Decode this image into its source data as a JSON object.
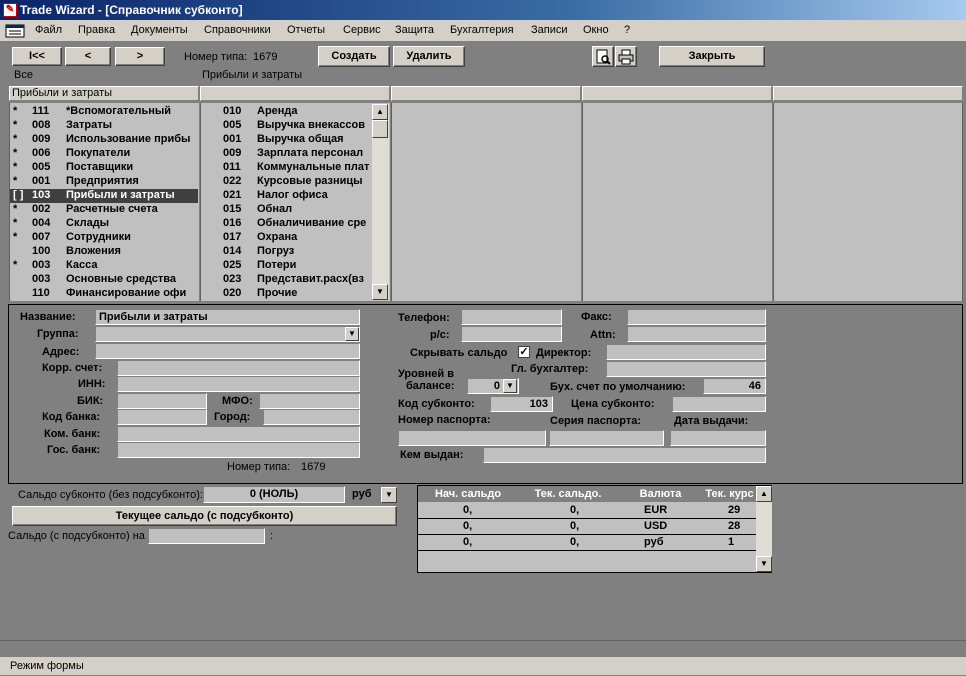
{
  "window": {
    "title": "Trade Wizard - [Справочник субконто]"
  },
  "menu": [
    "Файл",
    "Правка",
    "Документы",
    "Справочники",
    "Отчеты",
    "Сервис",
    "Защита",
    "Бухгалтерия",
    "Записи",
    "Окно",
    "?"
  ],
  "toolbar": {
    "first": "I<<",
    "prev": "<",
    "next": ">",
    "type_label": "Номер типа:",
    "type_value": "1679",
    "create": "Создать",
    "delete": "Удалить",
    "close": "Закрыть"
  },
  "breadcrumb": {
    "left": "Все",
    "right": "Прибыли и затраты"
  },
  "columns": {
    "first_header": "Прибыли и затраты"
  },
  "left_list": [
    {
      "mark": "*",
      "code": "111",
      "name": "*Вспомогательный"
    },
    {
      "mark": "*",
      "code": "008",
      "name": "Затраты"
    },
    {
      "mark": "*",
      "code": "009",
      "name": "Использование прибы"
    },
    {
      "mark": "*",
      "code": "006",
      "name": "Покупатели"
    },
    {
      "mark": "*",
      "code": "005",
      "name": "Поставщики"
    },
    {
      "mark": "*",
      "code": "001",
      "name": "Предприятия"
    },
    {
      "mark": "[ ]",
      "code": "103",
      "name": "Прибыли и затраты"
    },
    {
      "mark": "*",
      "code": "002",
      "name": "Расчетные счета"
    },
    {
      "mark": "*",
      "code": "004",
      "name": "Склады"
    },
    {
      "mark": "*",
      "code": "007",
      "name": "Сотрудники"
    },
    {
      "mark": "",
      "code": "100",
      "name": "Вложения"
    },
    {
      "mark": "*",
      "code": "003",
      "name": "Касса"
    },
    {
      "mark": "",
      "code": "003",
      "name": "Основные средства"
    },
    {
      "mark": "",
      "code": "110",
      "name": "Финансирование офи"
    }
  ],
  "right_list": [
    {
      "code": "010",
      "name": "Аренда"
    },
    {
      "code": "005",
      "name": "Выручка внекассов"
    },
    {
      "code": "001",
      "name": "Выручка общая"
    },
    {
      "code": "009",
      "name": "Зарплата персонал"
    },
    {
      "code": "011",
      "name": "Коммунальные плат"
    },
    {
      "code": "022",
      "name": "Курсовые разницы"
    },
    {
      "code": "021",
      "name": "Налог офиса"
    },
    {
      "code": "015",
      "name": "Обнал"
    },
    {
      "code": "016",
      "name": "Обналичивание сре"
    },
    {
      "code": "017",
      "name": "Охрана"
    },
    {
      "code": "014",
      "name": "Погруз"
    },
    {
      "code": "025",
      "name": "Потери"
    },
    {
      "code": "023",
      "name": "Представит.расх(вз"
    },
    {
      "code": "020",
      "name": "Прочие"
    }
  ],
  "form": {
    "name_label": "Название:",
    "name_value": "Прибыли и затраты",
    "group_label": "Группа:",
    "address_label": "Адрес:",
    "corr_label": "Корр. счет:",
    "inn_label": "ИНН:",
    "bik_label": "БИК:",
    "mfo_label": "МФО:",
    "bankcode_label": "Код банка:",
    "city_label": "Город:",
    "combank_label": "Ком. банк:",
    "govbank_label": "Гос. банк:",
    "type_label": "Номер типа:",
    "type_value": "1679",
    "phone_label": "Телефон:",
    "fax_label": "Факс:",
    "rs_label": "р/с:",
    "attn_label": "Attn:",
    "hide_label": "Скрывать сальдо",
    "hide_check": "✓",
    "director_label": "Директор:",
    "accountant_label": "Гл. бухгалтер:",
    "levels_label1": "Уровней в",
    "levels_label2": "балансе:",
    "levels_value": "0",
    "defacc_label": "Бух. счет по умолчанию:",
    "defacc_value": "46",
    "code_label": "Код субконто:",
    "code_value": "103",
    "price_label": "Цена субконто:",
    "passport_label": "Номер паспорта:",
    "series_label": "Серия паспорта:",
    "issue_label": "Дата выдачи:",
    "issuer_label": "Кем выдан:"
  },
  "balance": {
    "label": "Сальдо субконто (без подсубконто):",
    "value": "0 (НОЛЬ)",
    "currency": "руб",
    "current_button": "Текущее сальдо (с подсубконто)",
    "sub_label": "Сальдо (с подсубконто) на",
    "sub_colon": ":"
  },
  "grid": {
    "headers": [
      "Нач. сальдо",
      "Тек. сальдо.",
      "Валюта",
      "Тек. курс"
    ],
    "rows": [
      [
        "0,",
        "0,",
        "EUR",
        "29"
      ],
      [
        "0,",
        "0,",
        "USD",
        "28"
      ],
      [
        "0,",
        "0,",
        "руб",
        "1"
      ]
    ]
  },
  "status": "Режим формы"
}
